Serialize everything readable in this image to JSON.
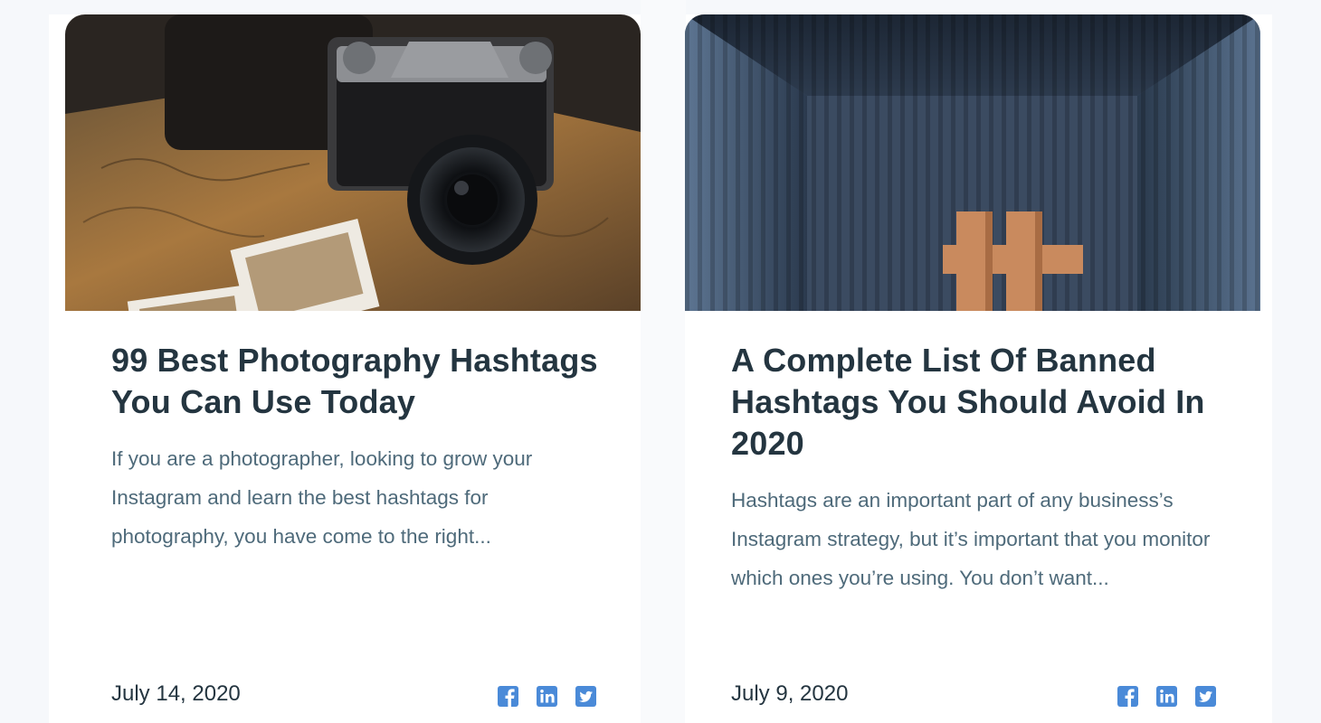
{
  "posts": [
    {
      "title": "99 Best Photography Hashtags You Can Use Today",
      "excerpt": "If you are a photographer, looking to grow your Instagram and learn the best hashtags for photography, you have come to the right...",
      "date": "July 14, 2020",
      "image_alt": "Vintage camera on a map with photos"
    },
    {
      "title": "A Complete List Of Banned Hashtags You Should Avoid In 2020",
      "excerpt": "Hashtags are an important part of any business’s Instagram strategy, but it’s important that you monitor which ones you’re using. You don’t want...",
      "date": "July 9, 2020",
      "image_alt": "Wooden hashtag symbol inside a shipping container"
    }
  ],
  "share": {
    "facebook": "facebook-icon",
    "linkedin": "linkedin-icon",
    "twitter": "twitter-icon"
  },
  "colors": {
    "title": "#243540",
    "excerpt": "#4e6a7a",
    "share_icon": "#4a8ad8",
    "background": "#f6f8fb"
  }
}
